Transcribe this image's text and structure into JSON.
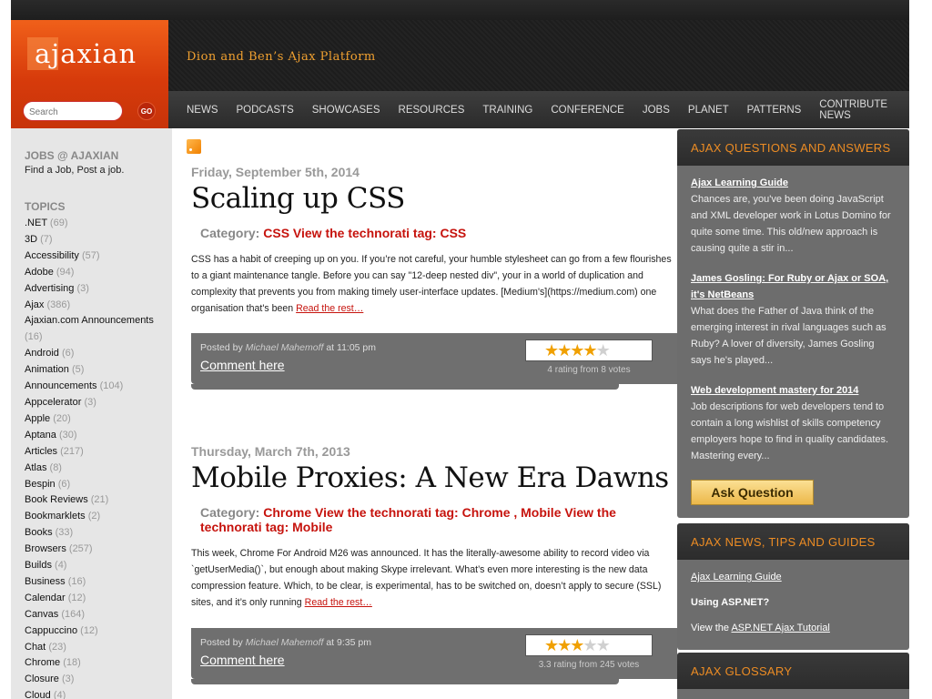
{
  "header": {
    "logo": "ajaxian",
    "tagline": "Dion and Ben’s Ajax Platform",
    "search_placeholder": "Search",
    "search_go": "GO",
    "nav": [
      "NEWS",
      "PODCASTS",
      "SHOWCASES",
      "RESOURCES",
      "TRAINING",
      "CONFERENCE",
      "JOBS",
      "PLANET",
      "PATTERNS",
      "CONTRIBUTE NEWS"
    ]
  },
  "left": {
    "jobs_title": "JOBS @ AJAXIAN",
    "jobs_sub": "Find a Job, Post a job.",
    "topics_title": "TOPICS",
    "topics": [
      {
        "name": ".NET",
        "count": "(69)"
      },
      {
        "name": "3D",
        "count": "(7)"
      },
      {
        "name": "Accessibility",
        "count": "(57)"
      },
      {
        "name": "Adobe",
        "count": "(94)"
      },
      {
        "name": "Advertising",
        "count": "(3)"
      },
      {
        "name": "Ajax",
        "count": "(386)"
      },
      {
        "name": "Ajaxian.com Announcements",
        "count": "(16)"
      },
      {
        "name": "Android",
        "count": "(6)"
      },
      {
        "name": "Animation",
        "count": "(5)"
      },
      {
        "name": "Announcements",
        "count": "(104)"
      },
      {
        "name": "Appcelerator",
        "count": "(3)"
      },
      {
        "name": "Apple",
        "count": "(20)"
      },
      {
        "name": "Aptana",
        "count": "(30)"
      },
      {
        "name": "Articles",
        "count": "(217)"
      },
      {
        "name": "Atlas",
        "count": "(8)"
      },
      {
        "name": "Bespin",
        "count": "(6)"
      },
      {
        "name": "Book Reviews",
        "count": "(21)"
      },
      {
        "name": "Bookmarklets",
        "count": "(2)"
      },
      {
        "name": "Books",
        "count": "(33)"
      },
      {
        "name": "Browsers",
        "count": "(257)"
      },
      {
        "name": "Builds",
        "count": "(4)"
      },
      {
        "name": "Business",
        "count": "(16)"
      },
      {
        "name": "Calendar",
        "count": "(12)"
      },
      {
        "name": "Canvas",
        "count": "(164)"
      },
      {
        "name": "Cappuccino",
        "count": "(12)"
      },
      {
        "name": "Chat",
        "count": "(23)"
      },
      {
        "name": "Chrome",
        "count": "(18)"
      },
      {
        "name": "Closure",
        "count": "(3)"
      },
      {
        "name": "Cloud",
        "count": "(4)"
      }
    ]
  },
  "posts": [
    {
      "date": "Friday, September 5th, 2014",
      "title": "Scaling up CSS",
      "category_label": "Category:",
      "category_links": "CSS View the technorati tag: CSS",
      "body": "CSS has a habit of creeping up on you. If you’re not careful, your humble stylesheet can go from a few flourishes to a giant maintenance tangle. Before you can say \"12-deep nested div\", your in a world of duplication and complexity that prevents you from making timely user-interface updates. [Medium's](https://medium.com) one organisation that's been",
      "read_more": "Read the rest…",
      "posted_by": "Posted by",
      "author": "Michael Mahemoff",
      "time": "at 11:05 pm",
      "comment": "Comment here",
      "rating": 4,
      "votes": "4 rating from 8 votes"
    },
    {
      "date": "Thursday, March 7th, 2013",
      "title": "Mobile Proxies: A New Era Dawns",
      "category_label": "Category:",
      "category_links": "Chrome View the technorati tag: Chrome , Mobile View the technorati tag: Mobile",
      "body": "This week, Chrome For Android M26 was announced. It has the literally-awesome ability to record video via `getUserMedia()`, but enough about making Skype irrelevant. What’s even more interesting is the new data compression feature. Which, to be clear, is experimental, has to be switched on, doesn’t apply to secure (SSL) sites, and it’s only running",
      "read_more": "Read the rest…",
      "posted_by": "Posted by",
      "author": "Michael Mahemoff",
      "time": "at 9:35 pm",
      "comment": "Comment here",
      "rating": 3,
      "votes": "3.3 rating from 245 votes"
    }
  ],
  "right": {
    "qa_title": "AJAX QUESTIONS AND ANSWERS",
    "qa_items": [
      {
        "title": "Ajax Learning Guide",
        "text": "Chances are, you've been doing JavaScript and XML developer work in Lotus Domino for quite some time. This old/new approach is causing quite a stir in..."
      },
      {
        "title": "James Gosling: For Ruby or Ajax or SOA, it's NetBeans",
        "text": "What does the Father of Java think of the emerging interest in rival languages such as Ruby? A lover of diversity, James Gosling says he's played..."
      },
      {
        "title": "Web development mastery for 2014",
        "text": "Job descriptions for web developers tend to contain a long wishlist of skills competency employers hope to find in quality candidates. Mastering every..."
      }
    ],
    "ask_button": "Ask Question",
    "news_title": "AJAX NEWS, TIPS AND GUIDES",
    "news_link1": "Ajax Learning Guide",
    "news_heading": "Using ASP.NET?",
    "news_view": "View the",
    "news_link2": "ASP.NET Ajax Tutorial",
    "glossary_title": "AJAX GLOSSARY"
  }
}
